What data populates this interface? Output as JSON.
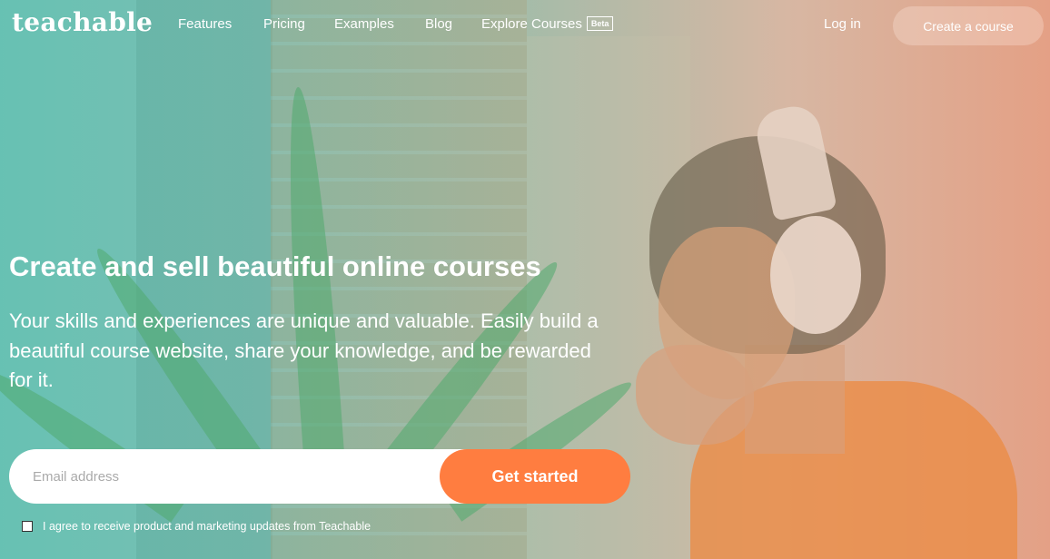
{
  "brand": {
    "logo": "teachable"
  },
  "nav": {
    "links": [
      {
        "label": "Features"
      },
      {
        "label": "Pricing"
      },
      {
        "label": "Examples"
      },
      {
        "label": "Blog"
      },
      {
        "label": "Explore Courses",
        "badge": "Beta"
      }
    ],
    "login_label": "Log in",
    "cta_label": "Create a course"
  },
  "hero": {
    "headline": "Create and sell beautiful online courses",
    "subtext": "Your skills and experiences are unique and valuable. Easily build a beautiful course website, share your knowledge, and be rewarded for it."
  },
  "signup": {
    "email_placeholder": "Email address",
    "email_value": "",
    "submit_label": "Get started",
    "consent_label": "I agree to receive product and marketing updates from Teachable",
    "consent_checked": false
  },
  "colors": {
    "accent": "#ff7d40",
    "gradient_left": "#5fbeaf",
    "gradient_right": "#e19678"
  }
}
